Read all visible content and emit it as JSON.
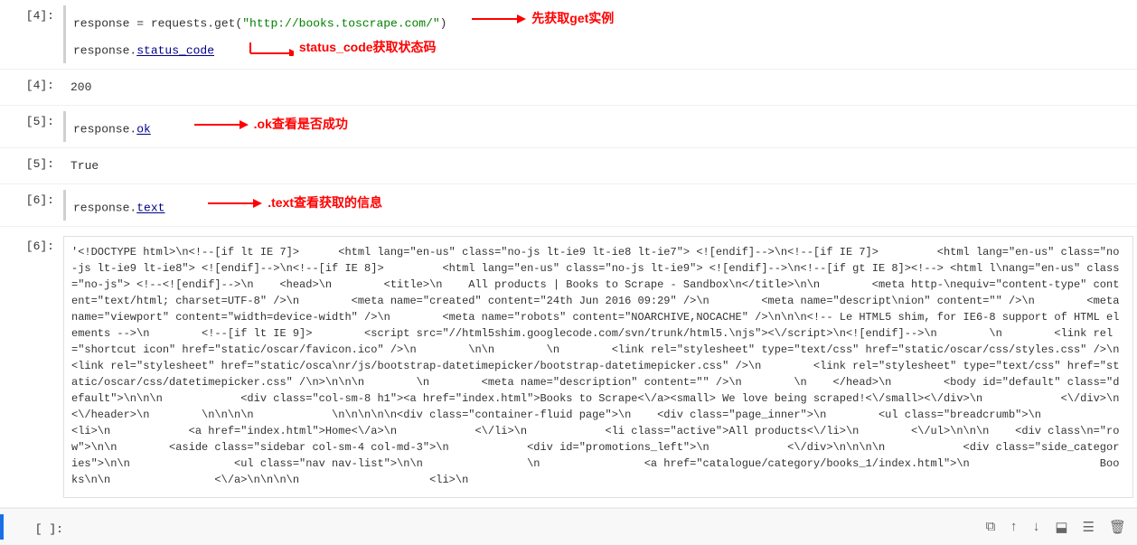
{
  "cells": [
    {
      "number": "[4]:",
      "type": "input",
      "lines": [
        "response = requests.get(\"http://books.toscrape.com/\")",
        "response.status_code"
      ],
      "annotation1": {
        "text": "先获取get实例",
        "arrow": true
      },
      "annotation2": {
        "text": "status_code获取状态码",
        "arrow": true
      }
    },
    {
      "number": "[4]:",
      "type": "output",
      "lines": [
        "200"
      ]
    },
    {
      "number": "[5]:",
      "type": "input",
      "lines": [
        "response.ok"
      ],
      "annotation1": {
        "text": ".ok查看是否成功",
        "arrow": true
      }
    },
    {
      "number": "[5]:",
      "type": "output",
      "lines": [
        "True"
      ]
    },
    {
      "number": "[6]:",
      "type": "input",
      "lines": [
        "response.text"
      ],
      "annotation1": {
        "text": ".text查看获取的信息",
        "arrow": true
      }
    },
    {
      "number": "[6]:",
      "type": "output-block",
      "content": "'<!DOCTYPE html>\\n<!--[if lt IE 7]>      <html lang=\"en-us\" class=\"no-js lt-ie9 lt-ie8 lt-ie7\"> <![endif]-->\\n<!--[if IE 7]>         <html lang=\"en-us\" class=\"no-js lt-ie9 lt-ie8\"> <![endif]-->\\n<!--[if IE 8]>         <html lang=\"en-us\" class=\"no-js lt-ie9\"> <![endif]-->\\n<!--[if gt IE 8]><!--> <html l\\nang=\"en-us\" class=\"no-js\"> <!--<![endif]-->\\n    <head>\\n        <title>\\n    All products | Books to Scrape - Sandbox\\n</title>\\n\\n        <meta http-\\nequiv=\"content-type\" content=\"text/html; charset=UTF-8\" />\\n        <meta name=\"created\" content=\"24th Jun 2016 09:29\" />\\n        <meta name=\"descript\\nion\" content=\"\" />\\n        <meta name=\"viewport\" content=\"width=device-width\" />\\n        <meta name=\"robots\" content=\"NOARCHIVE,NOCACHE\" />\\n\\n\\n<!-- Le HTML5 shim, for IE6-8 support of HTML elements -->\\n        <!--[if lt IE 9]>        <script src=\"//html5shim.googlecode.com/svn/trunk/html5.\\njs\"><\\/script>\\n<![endif]-->\\n        \\n        <link rel=\"shortcut icon\" href=\"static/oscar/favicon.ico\" />\\n        \\n\\n        \\n        <link rel=\"stylesheet\" type=\"text/css\" href=\"static/oscar/css/styles.css\" />\\n        <link rel=\"stylesheet\" href=\"static/osca\\nr/js/bootstrap-datetimepicker/bootstrap-datetimepicker.css\" />\\n        <link rel=\"stylesheet\" type=\"text/css\" href=\"static/oscar/css/datetimepicker.css\" /\\n>\\n\\n\\n        \\n        <meta name=\"description\" content=\"\" />\\n        \\n    </head>\\n        <body id=\"default\" class=\"default\">\\n\\n\\n            <div class=\"col-sm-8 h1\"><a href=\"index.html\">Books to Scrape<\\/a><small> We love being scraped!<\\/small><\\/div>\\n            <\\/div>\\n        <\\/header>\\n        \\n\\n\\n\\n            \\n\\n\\n\\n\\n<div class=\"container-fluid page\">\\n    <div class=\"page_inner\">\\n        <ul class=\"breadcrumb\">\\n            <li>\\n            <a href=\"index.html\">Home<\\/a>\\n            <\\/li>\\n            <li class=\"active\">All products<\\/li>\\n        <\\/ul>\\n\\n\\n    <div class\\n=\"row\">\\n\\n        <aside class=\"sidebar col-sm-4 col-md-3\">\\n            <div id=\"promotions_left\">\\n            <\\/div>\\n\\n\\n\\n            <div class=\"side_categories\">\\n\\n                <ul class=\"nav nav-list\">\\n\\n                \\n                <a href=\"catalogue/category/books_1/index.html\">\\n                    Books\\n\\n                <\\/a>\\n\\n\\n\\n                    <li>\\n"
    }
  ],
  "empty_cell": {
    "number": "[ ]:",
    "toolbar": {
      "icons": [
        "copy",
        "up",
        "down",
        "save",
        "align",
        "delete"
      ]
    }
  },
  "colors": {
    "red": "#cc0000",
    "blue": "#1a6fe8",
    "code_string": "#008000",
    "code_attr": "#00008b"
  }
}
